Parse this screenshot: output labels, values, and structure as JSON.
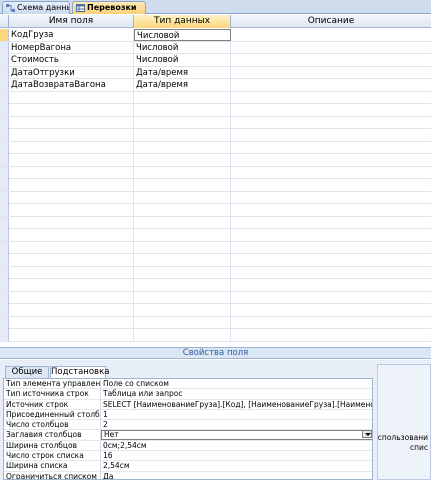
{
  "tabs": [
    {
      "label": "Схема данных",
      "icon": "relationships-icon"
    },
    {
      "label": "Перевозки",
      "icon": "table-icon"
    }
  ],
  "grid": {
    "columns": [
      "Имя поля",
      "Тип данных",
      "Описание"
    ],
    "rows": [
      {
        "name": "КодГруза",
        "type": "Числовой",
        "desc": ""
      },
      {
        "name": "НомерВагона",
        "type": "Числовой",
        "desc": ""
      },
      {
        "name": "Стоимость",
        "type": "Числовой",
        "desc": ""
      },
      {
        "name": "ДатаОтгрузки",
        "type": "Дата/время",
        "desc": ""
      },
      {
        "name": "ДатаВозвратаВагона",
        "type": "Дата/время",
        "desc": ""
      }
    ]
  },
  "field_props": {
    "title": "Свойства поля",
    "tabs": [
      "Общие",
      "Подстановка"
    ],
    "rows": [
      {
        "label": "Тип элемента управления",
        "value": "Поле со списком"
      },
      {
        "label": "Тип источника строк",
        "value": "Таблица или запрос"
      },
      {
        "label": "Источник строк",
        "value": "SELECT [НаименованиеГруза].[Код], [НаименованиеГруза].[Наименование] FR"
      },
      {
        "label": "Присоединенный столбец",
        "value": "1"
      },
      {
        "label": "Число столбцов",
        "value": "2"
      },
      {
        "label": "Заглавия столбцов",
        "value": "Нет"
      },
      {
        "label": "Ширина столбцов",
        "value": "0см;2,54см"
      },
      {
        "label": "Число строк списка",
        "value": "16"
      },
      {
        "label": "Ширина списка",
        "value": "2,54см"
      },
      {
        "label": "Ограничиться списком",
        "value": "Да"
      }
    ]
  },
  "help": {
    "line1": "Использовани",
    "line2": "спис"
  }
}
